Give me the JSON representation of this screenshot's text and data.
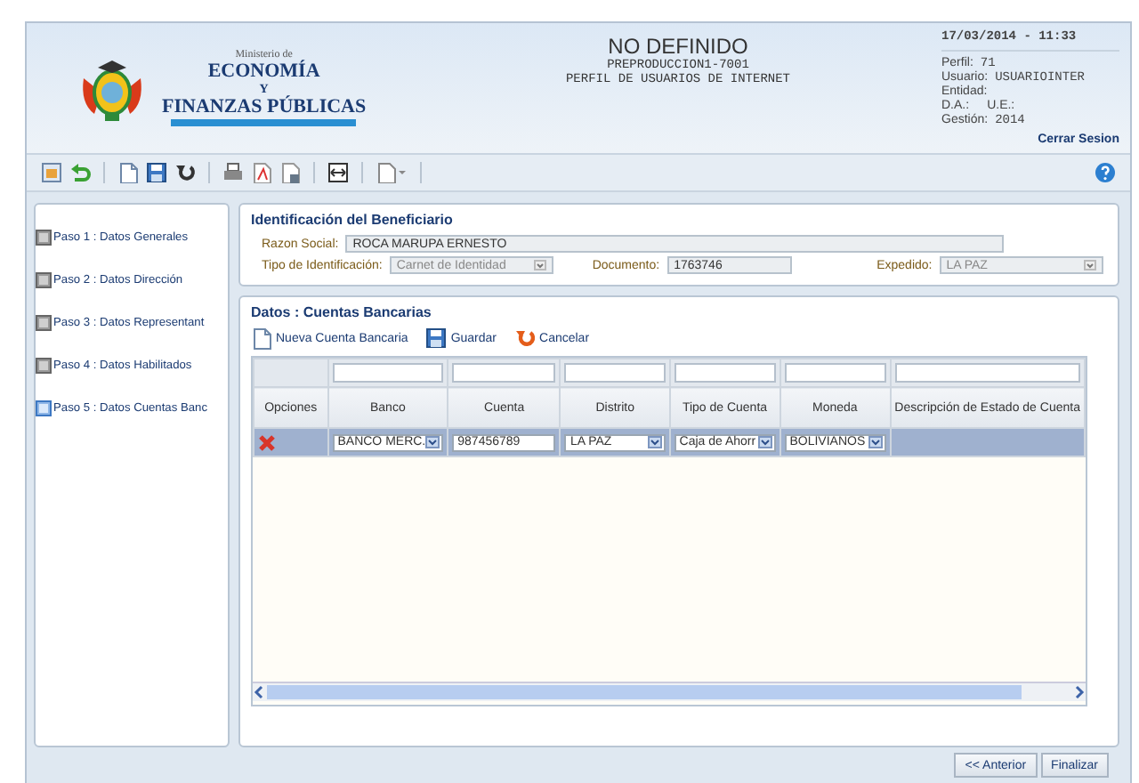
{
  "header": {
    "ministry_small": "Ministerio de",
    "ministry_name": "ECONOMÍA",
    "ministry_joiner": "Y",
    "ministry_name2": "FINANZAS PÚBLICAS",
    "title": "NO DEFINIDO",
    "subtitle": "PREPRODUCCION1-7001",
    "subtitle2": "PERFIL DE USUARIOS DE INTERNET",
    "datetime": "17/03/2014 - 11:33",
    "info": [
      {
        "label": "Perfil:",
        "value": "71"
      },
      {
        "label": "Usuario:",
        "value": "USUARIOINTER"
      },
      {
        "label": "Entidad:"
      },
      {
        "label": "D.A.:",
        "label2": "U.E.:"
      },
      {
        "label": "Gestión:",
        "value": "2014"
      }
    ],
    "logout": "Cerrar Sesion"
  },
  "steps": [
    {
      "label": "Paso 1 : Datos Generales",
      "selected": false
    },
    {
      "label": "Paso 2 : Datos Dirección",
      "selected": false
    },
    {
      "label": "Paso 3 : Datos Representant",
      "selected": false
    },
    {
      "label": "Paso 4 : Datos Habilitados",
      "selected": false
    },
    {
      "label": "Paso 5 : Datos Cuentas Banc",
      "selected": true
    }
  ],
  "beneficiary": {
    "title": "Identificación del Beneficiario",
    "razon_social": {
      "label": "Razon Social:",
      "value": "ROCA MARUPA ERNESTO"
    },
    "tipo": {
      "label": "Tipo de Identificación:",
      "value": "Carnet de Identidad",
      "disabled": true
    },
    "documento": {
      "label": "Documento:",
      "value": "1763746"
    },
    "expedido": {
      "label": "Expedido:",
      "value": "LA PAZ",
      "disabled": true
    }
  },
  "accounts": {
    "title": "Datos : Cuentas Bancarias",
    "actions": [
      {
        "kind": "new",
        "label": "Nueva Cuenta Bancaria"
      },
      {
        "kind": "save",
        "label": "Guardar"
      },
      {
        "kind": "cancel",
        "label": "Cancelar"
      }
    ],
    "columns": [
      "Opciones",
      "Banco",
      "Cuenta",
      "Distrito",
      "Tipo de Cuenta",
      "Moneda",
      "Descripción de Estado de Cuenta"
    ],
    "rows": [
      {
        "selected": true,
        "cells": [
          {
            "kind": "delete"
          },
          {
            "kind": "select",
            "value": "BANCO MERC."
          },
          {
            "kind": "input",
            "value": "987456789"
          },
          {
            "kind": "select",
            "value": "LA PAZ"
          },
          {
            "kind": "select",
            "value": "Caja de Ahorr"
          },
          {
            "kind": "select",
            "value": "BOLIVIANOS"
          },
          {
            "kind": "empty"
          }
        ]
      }
    ]
  },
  "footer": {
    "buttons": [
      "<< Anterior",
      "Finalizar"
    ]
  }
}
